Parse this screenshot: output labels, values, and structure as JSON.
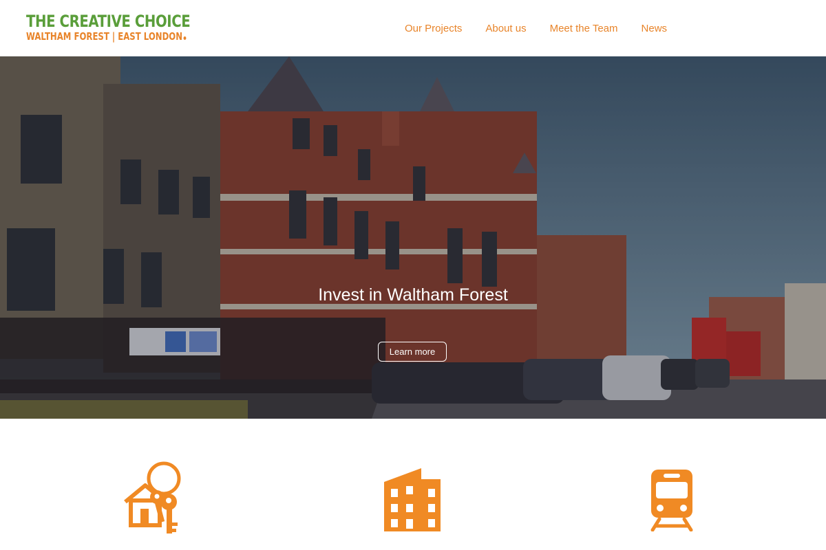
{
  "header": {
    "logo_title": "THE CREATIVE CHOICE",
    "logo_subtitle": "WALTHAM FOREST | EAST LONDON"
  },
  "nav": {
    "items": [
      {
        "label": "Our Projects"
      },
      {
        "label": "About us"
      },
      {
        "label": "Meet the Team"
      },
      {
        "label": "News"
      }
    ]
  },
  "hero": {
    "title": "Invest in Waltham Forest",
    "button_label": "Learn more"
  },
  "features": {
    "icons": [
      "house-keys-icon",
      "buildings-icon",
      "train-icon"
    ]
  },
  "colors": {
    "brand_green": "#5a9e3a",
    "accent_orange": "#e8842a",
    "icon_orange": "#f08a24"
  }
}
